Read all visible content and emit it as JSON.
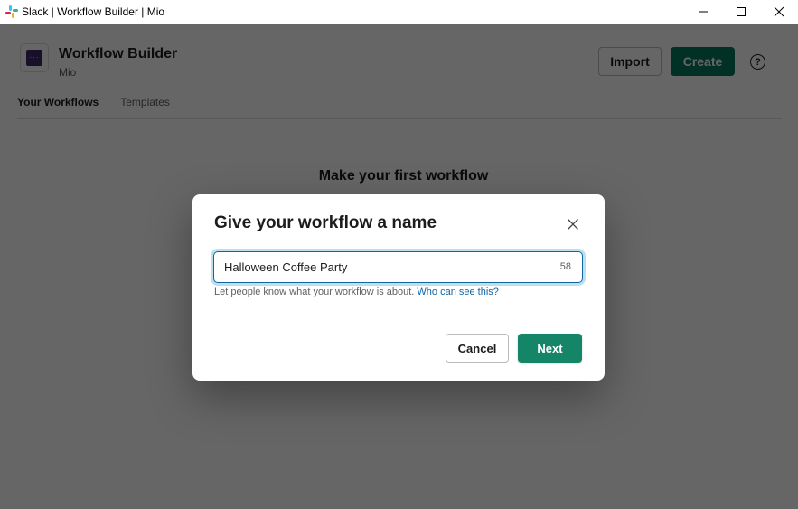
{
  "window": {
    "title": "Slack | Workflow Builder | Mio",
    "controls": [
      "minimize",
      "maximize",
      "close"
    ]
  },
  "header": {
    "app_title": "Workflow Builder",
    "workspace": "Mio",
    "import_label": "Import",
    "create_label": "Create",
    "help_glyph": "?"
  },
  "tabs": [
    {
      "label": "Your Workflows",
      "active": true
    },
    {
      "label": "Templates",
      "active": false
    }
  ],
  "empty_state": {
    "title": "Make your first workflow"
  },
  "modal": {
    "title": "Give your workflow a name",
    "name_input_value": "Halloween Coffee Party",
    "remaining_chars": "58",
    "hint_text": "Let people know what your workflow is about.",
    "hint_link": "Who can see this?",
    "cancel_label": "Cancel",
    "next_label": "Next"
  },
  "colors": {
    "accent": "#007a5a",
    "next_button": "#148567",
    "link": "#1264a3"
  }
}
